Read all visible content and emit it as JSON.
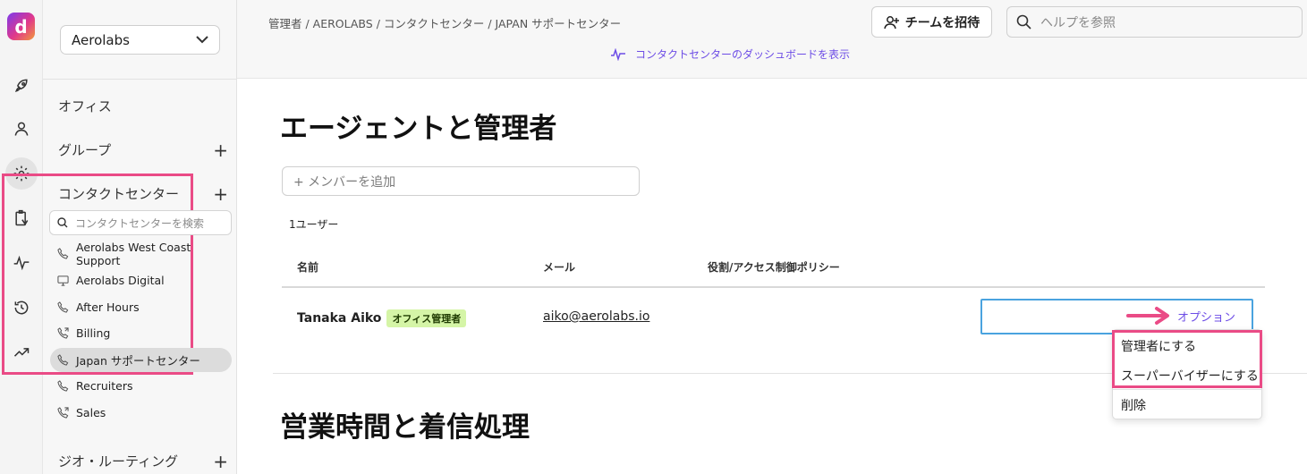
{
  "rail": {
    "logo_letter": "d",
    "icons": [
      "rocket-icon",
      "person-icon",
      "gear-icon",
      "clipboard-icon",
      "activity-icon",
      "history-icon",
      "trending-icon"
    ]
  },
  "sidebar": {
    "org": "Aerolabs",
    "sections": {
      "office": "オフィス",
      "group": "グループ",
      "contact_center": "コンタクトセンター",
      "geo_routing": "ジオ・ルーティング"
    },
    "search_placeholder": "コンタクトセンターを検索",
    "items": [
      {
        "label": "Aerolabs West Coast Support",
        "icon": "phone-icon"
      },
      {
        "label": "Aerolabs Digital",
        "icon": "monitor-icon"
      },
      {
        "label": "After Hours",
        "icon": "phone-icon"
      },
      {
        "label": "Billing",
        "icon": "phone-forward-icon"
      },
      {
        "label": "Japan サポートセンター",
        "icon": "phone-icon"
      },
      {
        "label": "Recruiters",
        "icon": "phone-icon"
      },
      {
        "label": "Sales",
        "icon": "phone-forward-icon"
      }
    ]
  },
  "header": {
    "breadcrumb": "管理者 / AEROLABS / コンタクトセンター / JAPAN サポートセンター",
    "dashboard_link": "コンタクトセンターのダッシュボードを表示",
    "invite_label": "チームを招待",
    "help_placeholder": "ヘルプを参照"
  },
  "main": {
    "title": "エージェントと管理者",
    "add_member_placeholder": "+ メンバーを追加",
    "user_count": "1ユーザー",
    "columns": {
      "name": "名前",
      "email": "メール",
      "role": "役割/アクセス制御ポリシー"
    },
    "row": {
      "name": "Tanaka Aiko",
      "badge": "オフィス管理者",
      "email": "aiko@aerolabs.io",
      "options_label": "オプション"
    },
    "section2_title": "営業時間と着信処理"
  },
  "menu": {
    "items": [
      "管理者にする",
      "スーパーバイザーにする",
      "削除"
    ]
  },
  "colors": {
    "accent": "#6d4de6",
    "highlight": "#ea4b86",
    "badge_bg": "#d5f5a7",
    "options_border": "#4aa3df"
  }
}
